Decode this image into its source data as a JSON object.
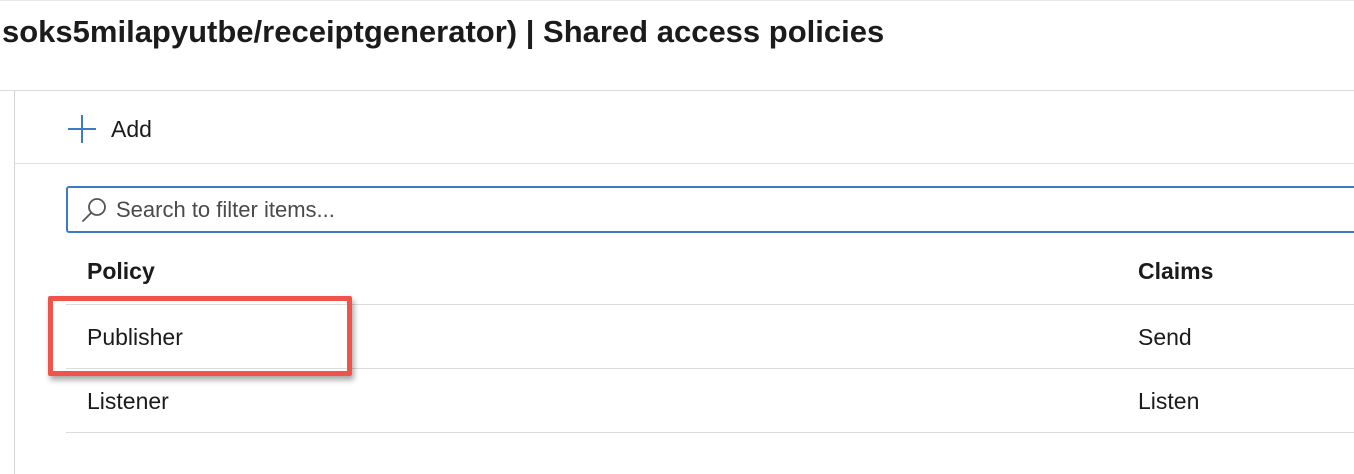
{
  "header": {
    "title": "soks5milapyutbe/receiptgenerator) | Shared access policies"
  },
  "toolbar": {
    "add_label": "Add"
  },
  "search": {
    "placeholder": "Search to filter items..."
  },
  "table": {
    "columns": [
      "Policy",
      "Claims"
    ],
    "rows": [
      {
        "policy": "Publisher",
        "claims": "Send"
      },
      {
        "policy": "Listener",
        "claims": "Listen"
      }
    ]
  },
  "colors": {
    "accent": "#3c7ac4",
    "highlight": "#f0534a"
  },
  "icons": {
    "add": "plus-icon",
    "search": "search-icon"
  }
}
